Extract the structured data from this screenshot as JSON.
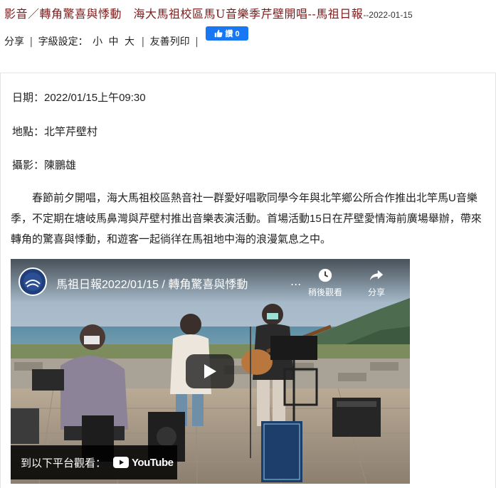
{
  "header": {
    "title": "影音／轉角驚喜與悸動　海大馬祖校區馬U音樂季芹壁開唱--馬祖日報",
    "date": "--2022-01-15"
  },
  "toolbar": {
    "share": "分享",
    "sep": "|",
    "font_label": "字級設定：",
    "font_small": "小",
    "font_medium": "中",
    "font_large": "大",
    "print": "友善列印"
  },
  "like_button": {
    "label": "讚 0",
    "color": "#1877f2"
  },
  "article": {
    "date_line": "日期：2022/01/15上午09:30",
    "place_line": "地點：北竿芹壁村",
    "photo_line": "攝影：陳鵬雄",
    "paragraph": "春節前夕開唱，海大馬祖校區熱音社一群愛好唱歌同學今年與北竿鄉公所合作推出北竿馬U音樂季，不定期在塘岐馬鼻灣與芹壁村推出音樂表演活動。首場活動15日在芹壁愛情海前廣場舉辦，帶來轉角的驚喜與悸動，和遊客一起徜徉在馬祖地中海的浪漫氣息之中。"
  },
  "video": {
    "title": "馬祖日報2022/01/15 / 轉角驚喜與悸動",
    "more": "...",
    "watch_later": "稍後觀看",
    "share": "分享",
    "watch_on": "到以下平台觀看：",
    "youtube": "YouTube",
    "icons": [
      "clock-icon",
      "share-arrow-icon",
      "play-icon",
      "youtube-logo-icon"
    ]
  },
  "colors": {
    "title": "#7b1b1b",
    "youtube_red": "#ff0000"
  }
}
